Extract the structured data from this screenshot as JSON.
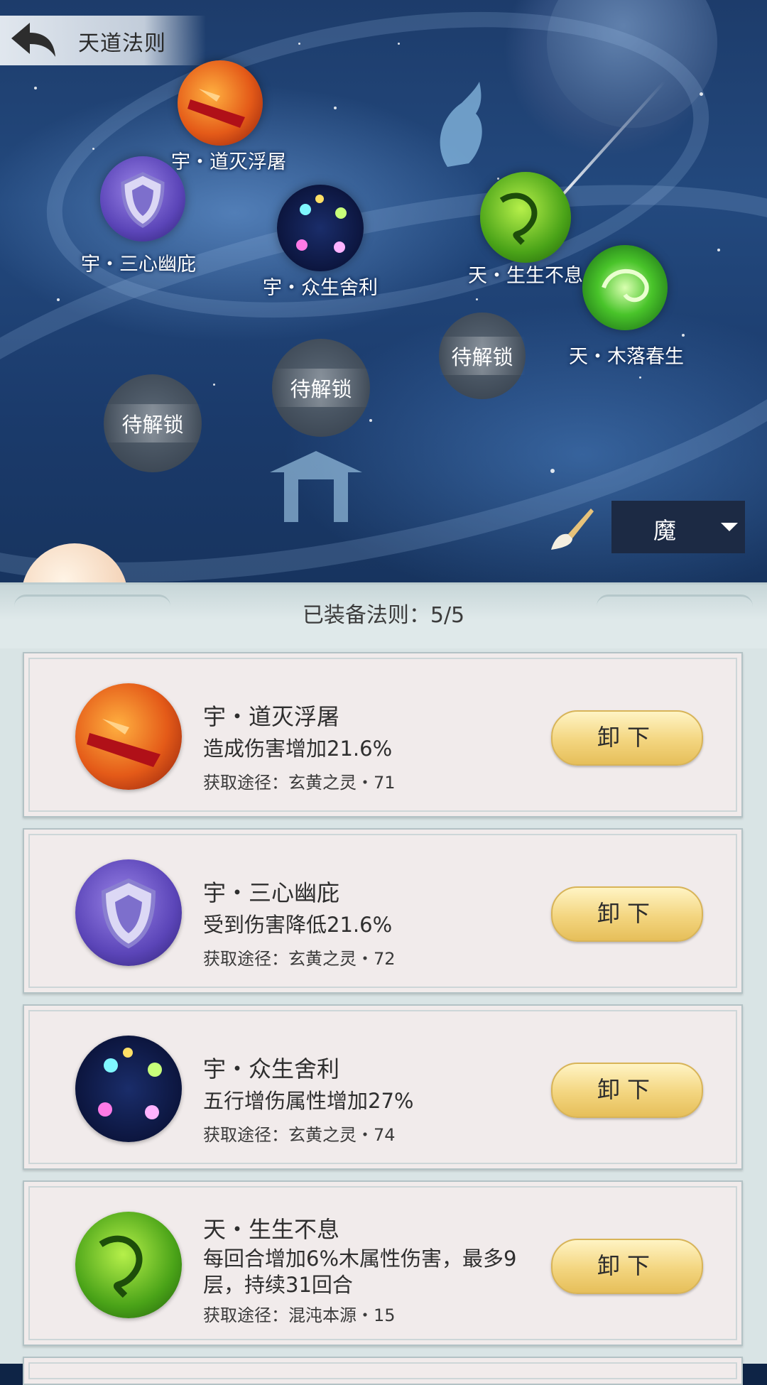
{
  "header": {
    "title": "天道法则"
  },
  "map": {
    "nodes": [
      {
        "label": "宇・道灭浮屠",
        "icon": "fire-blade-icon"
      },
      {
        "label": "宇・三心幽庇",
        "icon": "shield-icon"
      },
      {
        "label": "宇・众生舍利",
        "icon": "comet-orbs-icon"
      },
      {
        "label": "天・生生不息",
        "icon": "vine-icon"
      },
      {
        "label": "天・木落春生",
        "icon": "leaf-swirl-icon"
      }
    ],
    "locked": [
      "待解锁",
      "待解锁",
      "待解锁"
    ],
    "faction_select": {
      "value": "魔"
    }
  },
  "equipped": {
    "label": "已装备法则：5/5",
    "items": [
      {
        "name": "宇・道灭浮屠",
        "desc": "造成伤害增加21.6%",
        "source": "获取途径：玄黄之灵・71",
        "button": "卸下",
        "icon": "fire-blade-icon"
      },
      {
        "name": "宇・三心幽庇",
        "desc": "受到伤害降低21.6%",
        "source": "获取途径：玄黄之灵・72",
        "button": "卸下",
        "icon": "shield-icon"
      },
      {
        "name": "宇・众生舍利",
        "desc": "五行增伤属性增加27%",
        "source": "获取途径：玄黄之灵・74",
        "button": "卸下",
        "icon": "comet-orbs-icon"
      },
      {
        "name": "天・生生不息",
        "desc": "每回合增加6%木属性伤害，最多9层，持续31回合",
        "source": "获取途径：混沌本源・15",
        "button": "卸下",
        "icon": "vine-icon"
      }
    ]
  }
}
